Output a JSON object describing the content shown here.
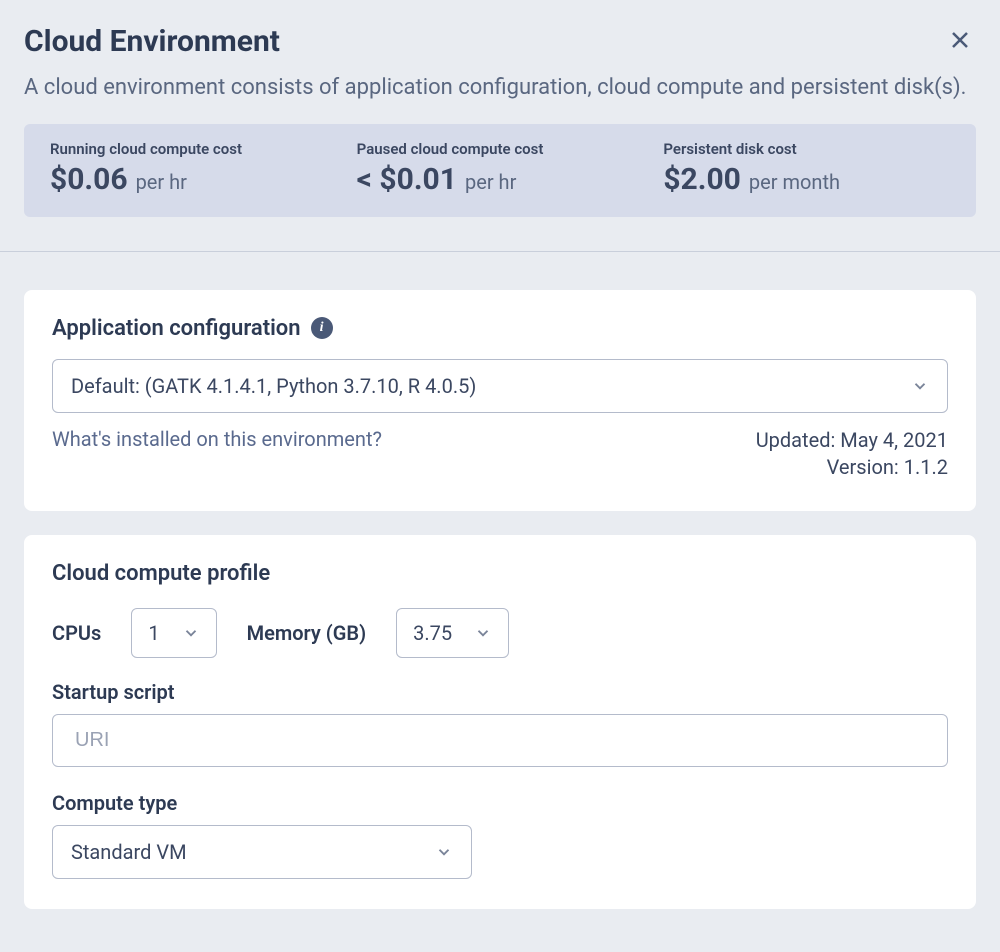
{
  "header": {
    "title": "Cloud Environment",
    "subtitle": "A cloud environment consists of application configuration, cloud compute and persistent disk(s)."
  },
  "costs": {
    "running": {
      "label": "Running cloud compute cost",
      "value": "$0.06",
      "unit": "per hr"
    },
    "paused": {
      "label": "Paused cloud compute cost",
      "value": "< $0.01",
      "unit": "per hr"
    },
    "disk": {
      "label": "Persistent disk cost",
      "value": "$2.00",
      "unit": "per month"
    }
  },
  "appConfig": {
    "title": "Application configuration",
    "selected": "Default: (GATK 4.1.4.1, Python 3.7.10, R 4.0.5)",
    "installedLink": "What's installed on this environment?",
    "updated": "Updated: May 4, 2021",
    "version": "Version: 1.1.2"
  },
  "computeProfile": {
    "title": "Cloud compute profile",
    "cpuLabel": "CPUs",
    "cpuValue": "1",
    "memLabel": "Memory (GB)",
    "memValue": "3.75",
    "startupLabel": "Startup script",
    "startupPlaceholder": "URI",
    "computeTypeLabel": "Compute type",
    "computeTypeValue": "Standard VM"
  }
}
